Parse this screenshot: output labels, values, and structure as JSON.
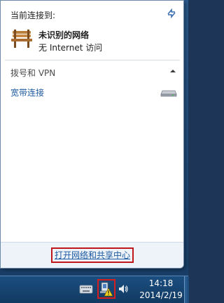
{
  "flyout": {
    "header_label": "当前连接到:",
    "network": {
      "name": "未识别的网络",
      "status": "无 Internet 访问",
      "icon": "bench-icon"
    },
    "section_title": "拨号和 VPN",
    "vpn_items": [
      {
        "label": "宽带连接",
        "icon": "modem-icon"
      }
    ],
    "footer_link": "打开网络和共享中心",
    "highlight_color": "#c0171d",
    "link_color": "#1e5aa0"
  },
  "taskbar": {
    "icons": [
      "keyboard-icon",
      "network-warning-icon",
      "volume-icon"
    ],
    "time": "14:18",
    "date": "2014/2/19"
  }
}
